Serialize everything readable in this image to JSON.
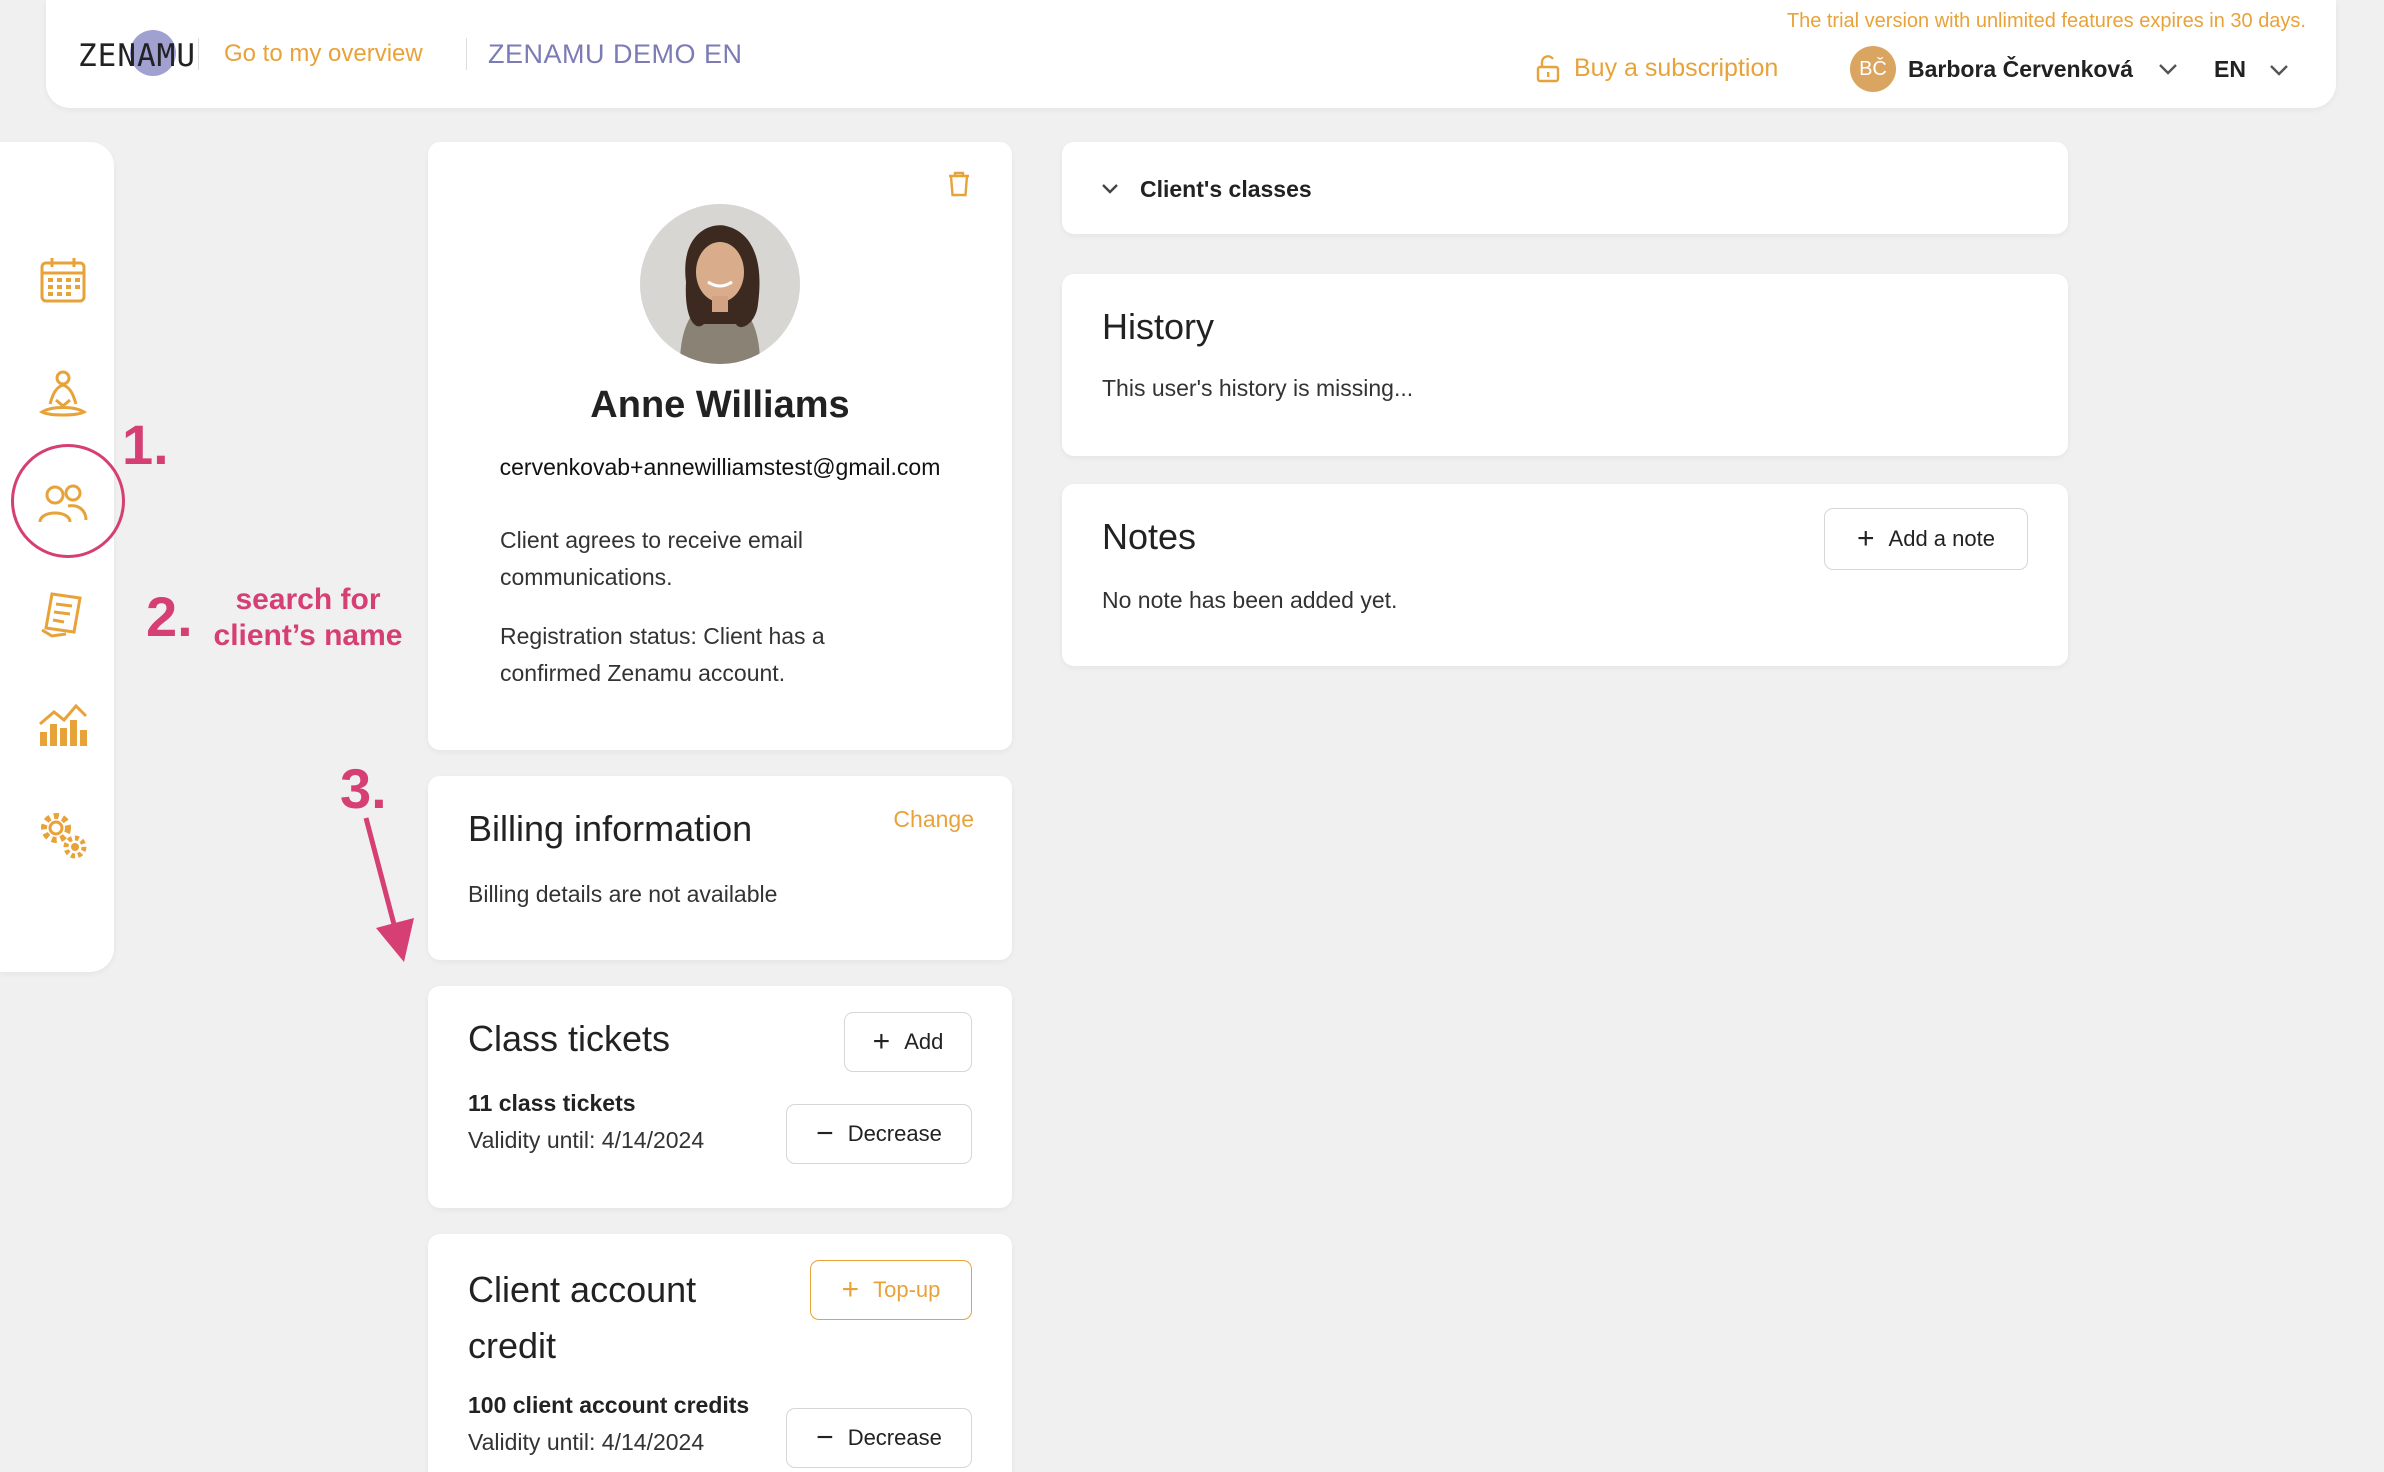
{
  "header": {
    "logo": "ZENAMU",
    "overview_link": "Go to my overview",
    "studio_name": "ZENAMU DEMO EN",
    "trial_notice": "The trial version with unlimited features expires in 30 days.",
    "buy_subscription": "Buy a subscription",
    "user_initials": "BČ",
    "user_name": "Barbora Červenková",
    "language": "EN"
  },
  "sidebar": {
    "items": [
      {
        "icon": "calendar-icon"
      },
      {
        "icon": "meditation-icon"
      },
      {
        "icon": "clients-icon"
      },
      {
        "icon": "document-icon"
      },
      {
        "icon": "chart-icon"
      },
      {
        "icon": "settings-icon"
      }
    ]
  },
  "annotations": {
    "step1": "1.",
    "step2": "2.",
    "step2_text_line1": "search for",
    "step2_text_line2": "client’s name",
    "step3": "3."
  },
  "client": {
    "name": "Anne Williams",
    "email": "cervenkovab+annewilliamstest@gmail.com",
    "consent": "Client agrees to receive email communications.",
    "registration": "Registration status: Client has a confirmed Zenamu account."
  },
  "billing": {
    "title": "Billing information",
    "change": "Change",
    "details": "Billing details are not available"
  },
  "tickets": {
    "title": "Class tickets",
    "add": "Add",
    "count": "11 class tickets",
    "validity": "Validity until: 4/14/2024",
    "decrease": "Decrease"
  },
  "credit": {
    "title_line1": "Client account",
    "title_line2": "credit",
    "topup": "Top-up",
    "count": "100 client account credits",
    "validity": "Validity until: 4/14/2024",
    "decrease": "Decrease"
  },
  "classes": {
    "title": "Client's classes"
  },
  "history": {
    "title": "History",
    "text": "This user's history is missing..."
  },
  "notes": {
    "title": "Notes",
    "add": "Add a note",
    "text": "No note has been added yet."
  },
  "colors": {
    "accent": "#e8a23a",
    "annotation": "#d63f74",
    "studio": "#7b7bb5"
  }
}
